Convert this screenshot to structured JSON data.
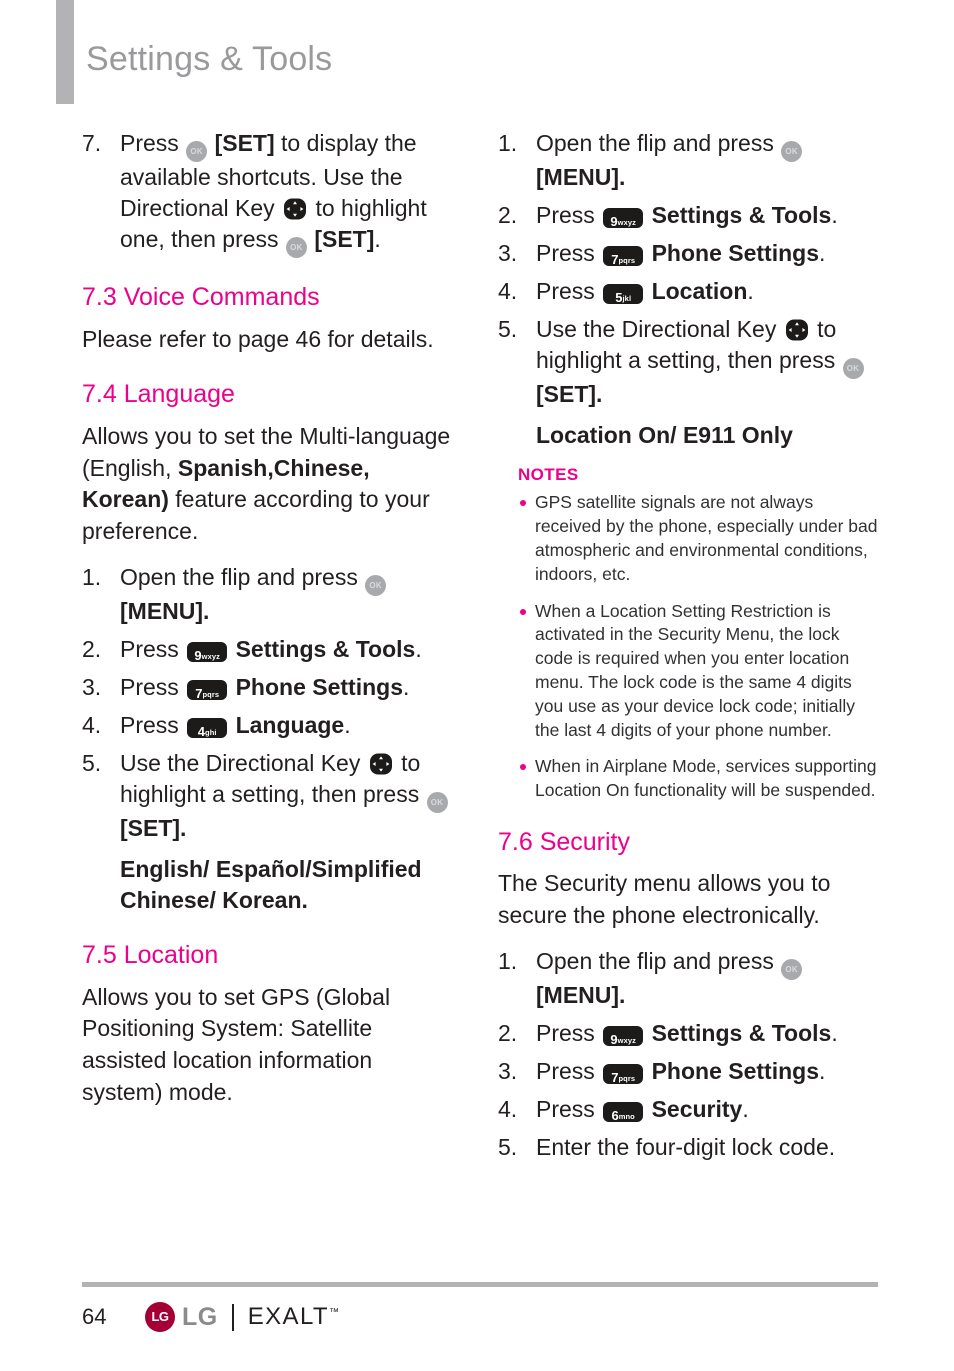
{
  "header": {
    "title": "Settings & Tools",
    "accent_color": "#ec008c",
    "title_color": "#9a9a9c"
  },
  "left_column": {
    "step7": {
      "num": "7.",
      "t1": "Press",
      "t2": "[SET] to display the available shortcuts. Use the Directional Key",
      "t3": "to highlight one, then press",
      "t4": "[SET]."
    },
    "voice_commands": {
      "heading": "7.3 Voice Commands",
      "paragraph": "Please refer to page 46 for details."
    },
    "language": {
      "heading": "7.4 Language",
      "intro_a": "Allows you to set the Multi-language (English,",
      "intro_b": "Spanish,Chinese, Korean)",
      "intro_c": "feature according to your preference.",
      "steps": [
        {
          "num": "1.",
          "pre": "Open the flip and press",
          "key": "ok",
          "post": "[MENU]."
        },
        {
          "num": "2.",
          "pre": "Press",
          "key_digit": "9",
          "key_letters": "wxyz",
          "label": "Settings & Tools",
          "post": "."
        },
        {
          "num": "3.",
          "pre": "Press",
          "key_digit": "7",
          "key_letters": "pqrs",
          "label": "Phone Settings",
          "post": "."
        },
        {
          "num": "4.",
          "pre": "Press",
          "key_digit": "4",
          "key_letters": "ghi",
          "label": "Language",
          "post": "."
        },
        {
          "num": "5.",
          "pre": "Use the Directional Key",
          "mid": "to highlight a setting, then press",
          "post": "[SET]."
        }
      ],
      "options": "English/ Español/Simplified Chinese/ Korean."
    },
    "location": {
      "heading": "7.5 Location",
      "paragraph": "Allows you to set GPS (Global Positioning System: Satellite assisted location information system) mode."
    }
  },
  "right_column": {
    "location_steps": [
      {
        "num": "1.",
        "pre": "Open the flip and press",
        "key": "ok",
        "post": "[MENU]."
      },
      {
        "num": "2.",
        "pre": "Press",
        "key_digit": "9",
        "key_letters": "wxyz",
        "label": "Settings & Tools",
        "post": "."
      },
      {
        "num": "3.",
        "pre": "Press",
        "key_digit": "7",
        "key_letters": "pqrs",
        "label": "Phone Settings",
        "post": "."
      },
      {
        "num": "4.",
        "pre": "Press",
        "key_digit": "5",
        "key_letters": "jkl",
        "label": "Location",
        "post": "."
      },
      {
        "num": "5.",
        "pre": "Use the Directional Key",
        "mid": "to highlight a setting, then press",
        "post": "[SET]."
      }
    ],
    "location_options": "Location On/ E911 Only",
    "notes": {
      "title": "NOTES",
      "items": [
        "GPS satellite signals are not always received by the phone, especially under bad atmospheric and environmental conditions, indoors, etc.",
        "When a Location Setting Restriction is activated in the Security Menu, the lock code is required when you enter location menu. The lock code is the same 4 digits you use as your device lock code; initially the last 4 digits of your phone number.",
        "When in Airplane Mode, services supporting Location On functionality will be suspended."
      ]
    },
    "security": {
      "heading": "7.6 Security",
      "paragraph": "The Security menu allows you to secure the phone electronically.",
      "steps": [
        {
          "num": "1.",
          "pre": "Open the flip and press",
          "key": "ok",
          "post": "[MENU]."
        },
        {
          "num": "2.",
          "pre": "Press",
          "key_digit": "9",
          "key_letters": "wxyz",
          "label": "Settings & Tools",
          "post": "."
        },
        {
          "num": "3.",
          "pre": "Press",
          "key_digit": "7",
          "key_letters": "pqrs",
          "label": "Phone Settings",
          "post": "."
        },
        {
          "num": "4.",
          "pre": "Press",
          "key_digit": "6",
          "key_letters": "mno",
          "label": "Security",
          "post": "."
        },
        {
          "num": "5.",
          "pre": "Enter the four-digit lock code."
        }
      ]
    }
  },
  "footer": {
    "page_number": "64",
    "brand": "LG",
    "mark_label": "LG",
    "product": "EXALT",
    "trademark": "™"
  },
  "icons": {
    "ok_key": "ok-key-icon",
    "directional_key": "directional-key-icon"
  }
}
